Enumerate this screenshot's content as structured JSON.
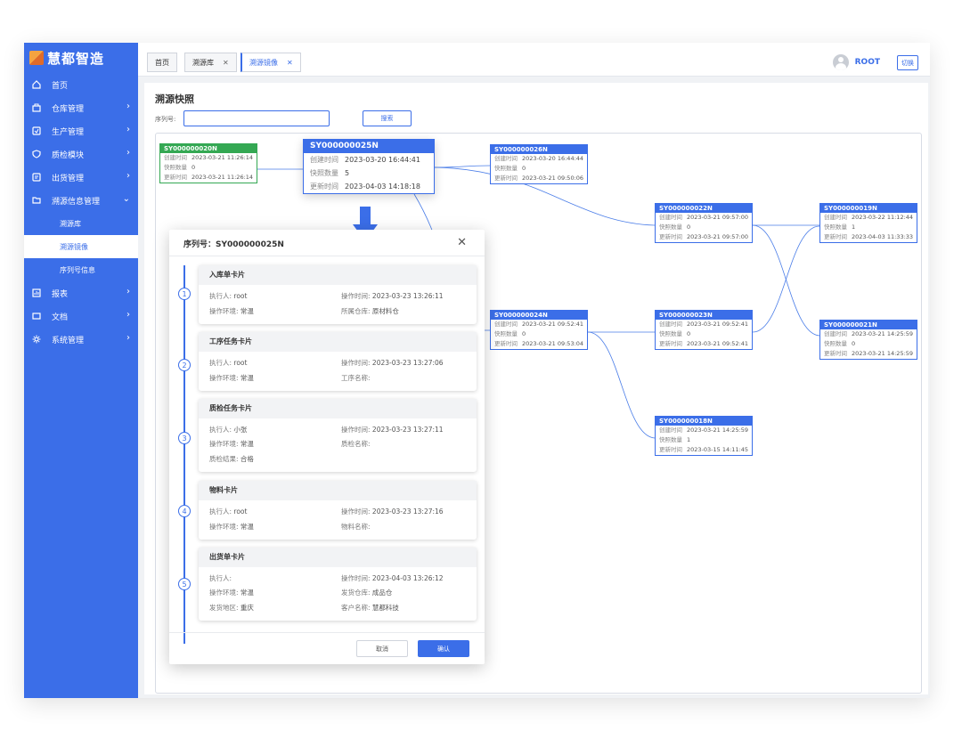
{
  "app": {
    "title": "慧都智造"
  },
  "sidebar": {
    "items": [
      {
        "label": "首页",
        "icon": "home-icon"
      },
      {
        "label": "仓库管理",
        "icon": "warehouse-icon"
      },
      {
        "label": "生产管理",
        "icon": "production-icon"
      },
      {
        "label": "质检模块",
        "icon": "shield-icon"
      },
      {
        "label": "出货管理",
        "icon": "shipping-icon"
      },
      {
        "label": "溯源信息管理",
        "icon": "folder-icon"
      },
      {
        "label": "报表",
        "icon": "report-icon"
      },
      {
        "label": "文档",
        "icon": "document-icon"
      },
      {
        "label": "系统管理",
        "icon": "gear-icon"
      }
    ],
    "subitems": [
      {
        "label": "溯源库"
      },
      {
        "label": "溯源镜像"
      },
      {
        "label": "序列号信息"
      }
    ]
  },
  "tabs": [
    {
      "label": "首页"
    },
    {
      "label": "溯源库"
    },
    {
      "label": "溯源镜像"
    }
  ],
  "user": {
    "name": "ROOT",
    "switch_label": "切换"
  },
  "page": {
    "title": "溯源快照",
    "search_label": "序列号:",
    "search_value": "",
    "search_button": "搜索"
  },
  "labels": {
    "created": "创建时间",
    "count": "快照数量",
    "updated": "更新时间"
  },
  "nodes": [
    {
      "id": "SY000000020N",
      "created": "2023-03-21 11:26:14",
      "count": "0",
      "updated": "2023-03-21 11:26:14"
    },
    {
      "id": "SY000000026N",
      "created": "2023-03-20 16:44:44",
      "count": "0",
      "updated": "2023-03-21 09:50:06"
    },
    {
      "id": "SY000000022N",
      "created": "2023-03-21 09:57:00",
      "count": "0",
      "updated": "2023-03-21 09:57:00"
    },
    {
      "id": "SY000000019N",
      "created": "2023-03-22 11:12:44",
      "count": "1",
      "updated": "2023-04-03 11:33:33"
    },
    {
      "id": "SY000000024N",
      "created": "2023-03-21 09:52:41",
      "count": "0",
      "updated": "2023-03-21 09:53:04"
    },
    {
      "id": "SY000000023N",
      "created": "2023-03-21 09:52:41",
      "count": "0",
      "updated": "2023-03-21 09:52:41"
    },
    {
      "id": "SY000000021N",
      "created": "2023-03-21 14:25:59",
      "count": "0",
      "updated": "2023-03-21 14:25:59"
    },
    {
      "id": "SY000000018N",
      "created": "2023-03-21 14:25:59",
      "count": "1",
      "updated": "2023-03-15 14:11:45"
    }
  ],
  "selected_node": {
    "id": "SY000000025N",
    "created": "2023-03-20 16:44:41",
    "count": "5",
    "updated": "2023-04-03 14:18:18"
  },
  "dialog": {
    "title": "序列号：SY000000025N",
    "cancel": "取消",
    "confirm": "确认",
    "cards": [
      {
        "step": "1",
        "title": "入库单卡片",
        "fields": [
          [
            "执行人:",
            "root"
          ],
          [
            "操作时间:",
            "2023-03-23 13:26:11"
          ],
          [
            "操作环境:",
            "常温"
          ],
          [
            "所属仓库:",
            "原材料仓"
          ]
        ]
      },
      {
        "step": "2",
        "title": "工序任务卡片",
        "fields": [
          [
            "执行人:",
            "root"
          ],
          [
            "操作时间:",
            "2023-03-23 13:27:06"
          ],
          [
            "操作环境:",
            "常温"
          ],
          [
            "工序名称:",
            ""
          ]
        ]
      },
      {
        "step": "3",
        "title": "质检任务卡片",
        "fields": [
          [
            "执行人:",
            "小张"
          ],
          [
            "操作时间:",
            "2023-03-23 13:27:11"
          ],
          [
            "操作环境:",
            "常温"
          ],
          [
            "质检名称:",
            ""
          ],
          [
            "质检结果:",
            "合格"
          ]
        ]
      },
      {
        "step": "4",
        "title": "物料卡片",
        "fields": [
          [
            "执行人:",
            "root"
          ],
          [
            "操作时间:",
            "2023-03-23 13:27:16"
          ],
          [
            "操作环境:",
            "常温"
          ],
          [
            "物料名称:",
            ""
          ]
        ]
      },
      {
        "step": "5",
        "title": "出货单卡片",
        "fields": [
          [
            "执行人:",
            ""
          ],
          [
            "操作时间:",
            "2023-04-03 13:26:12"
          ],
          [
            "操作环境:",
            "常温"
          ],
          [
            "发货仓库:",
            "成品仓"
          ],
          [
            "发货地区:",
            "重庆"
          ],
          [
            "客户名称:",
            "慧都科技"
          ]
        ]
      }
    ]
  },
  "colors": {
    "primary": "#3b6ee8",
    "success": "#34a853"
  }
}
